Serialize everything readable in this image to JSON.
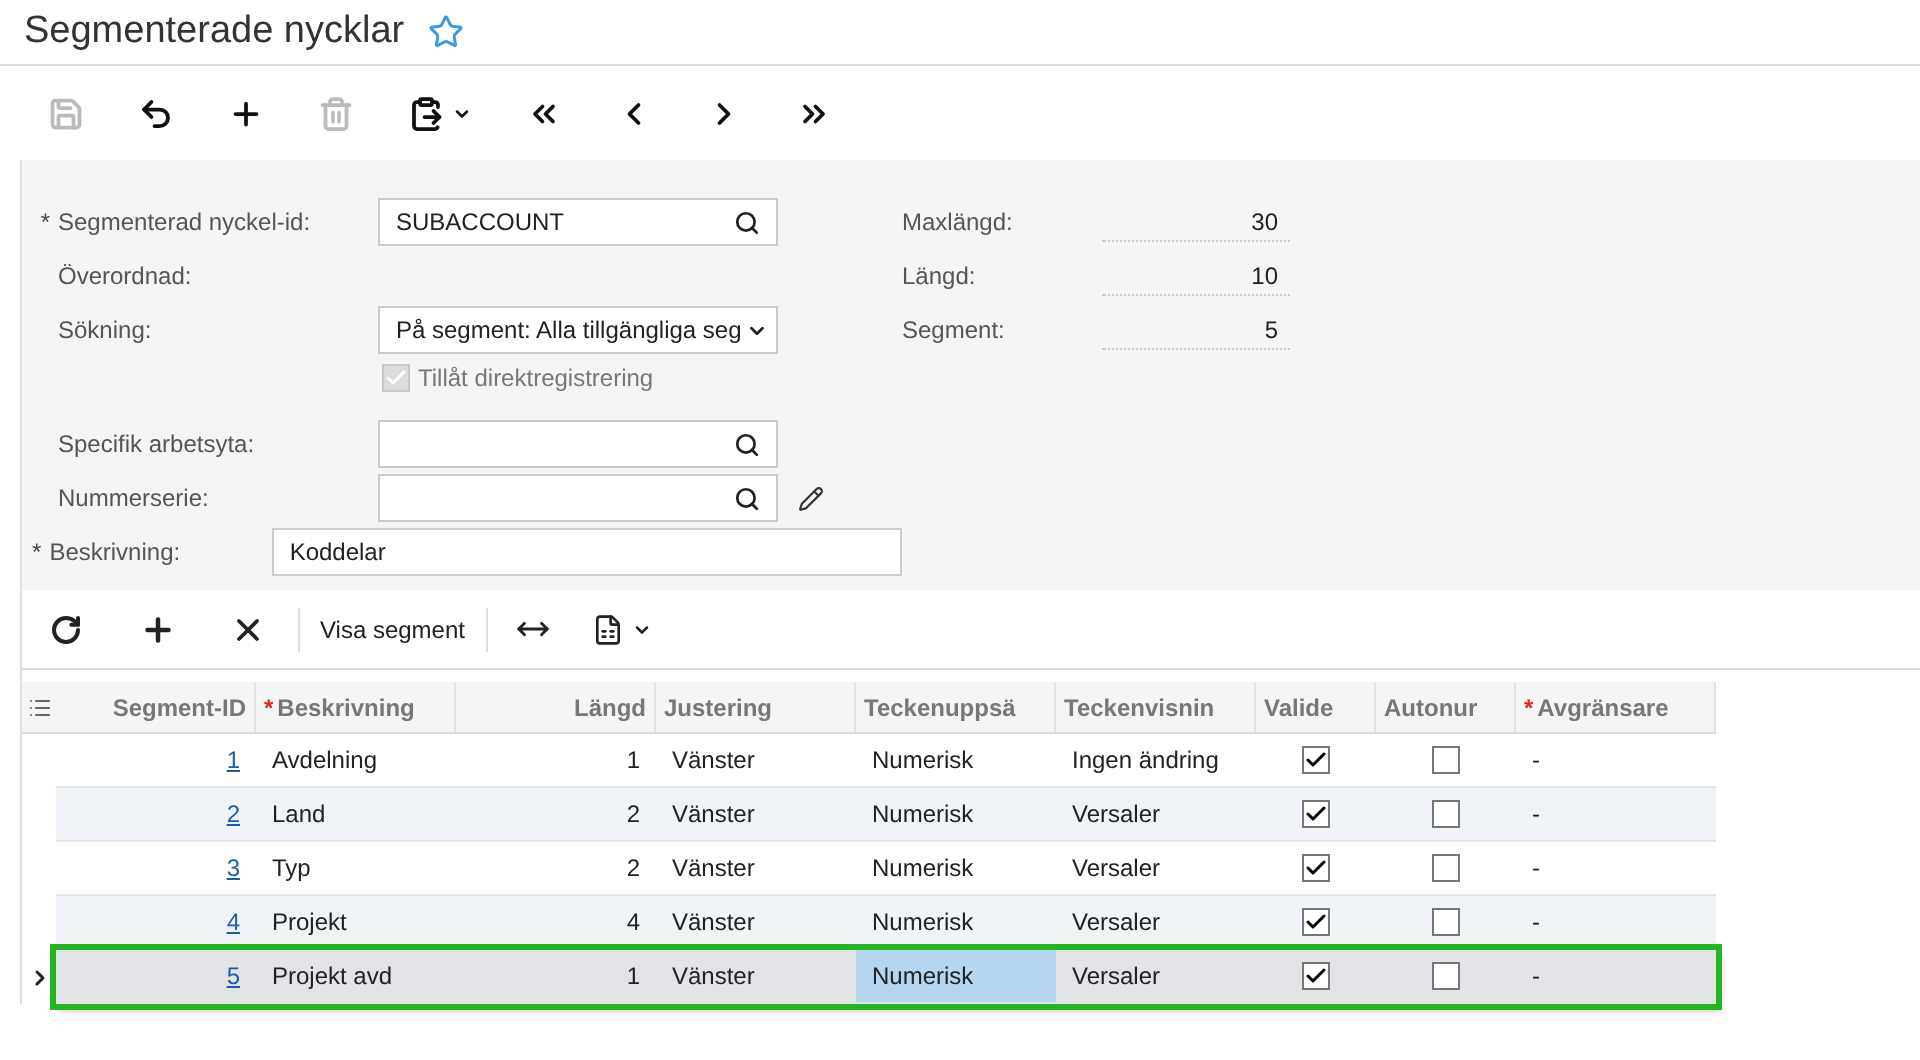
{
  "page": {
    "title": "Segmenterade nycklar",
    "favorite": false
  },
  "toolbar": [
    {
      "kind": "save",
      "disabled": true
    },
    {
      "kind": "undo",
      "disabled": false
    },
    {
      "kind": "add",
      "disabled": false
    },
    {
      "kind": "delete",
      "disabled": true
    },
    {
      "kind": "paste",
      "disabled": false
    },
    {
      "kind": "first",
      "disabled": false
    },
    {
      "kind": "prev",
      "disabled": false
    },
    {
      "kind": "next",
      "disabled": false
    },
    {
      "kind": "last",
      "disabled": false
    }
  ],
  "form": {
    "left": [
      {
        "mark": "*",
        "label": "Segmenterad nyckel-id:",
        "kind": "lookup",
        "value": "SUBACCOUNT"
      },
      {
        "label": "Överordnad:",
        "kind": "empty"
      },
      {
        "label": "Sökning:",
        "kind": "select",
        "value": "På segment: Alla tillgängliga seg"
      },
      {
        "label": "Tillåt direktregistrering",
        "kind": "checkbox",
        "checked": true,
        "disabled": true
      },
      {
        "label": "Specifik arbetsyta:",
        "kind": "lookup"
      },
      {
        "label": "Nummerserie:",
        "kind": "lookup-edit"
      },
      {
        "mark": "*",
        "label": "Beskrivning:",
        "kind": "text",
        "value": "Koddelar"
      }
    ],
    "right": [
      {
        "label": "Maxlängd:",
        "value": "30"
      },
      {
        "label": "Längd:",
        "value": "10"
      },
      {
        "label": "Segment:",
        "value": "5"
      }
    ]
  },
  "grid_toolbar": [
    {
      "kind": "refresh"
    },
    {
      "kind": "add"
    },
    {
      "kind": "remove"
    },
    {
      "kind": "text",
      "label": "Visa segment"
    },
    {
      "kind": "fit"
    },
    {
      "kind": "excel"
    }
  ],
  "table": {
    "columns": [
      {
        "label": "Segment-ID"
      },
      {
        "mark": "*",
        "label": "Beskrivning"
      },
      {
        "label": "Längd"
      },
      {
        "label": "Justering"
      },
      {
        "label": "Teckenuppsä"
      },
      {
        "label": "Teckenvisnin"
      },
      {
        "label": "Valide"
      },
      {
        "label": "Autonur"
      },
      {
        "mark": "*",
        "label": "Avgränsare"
      }
    ],
    "rows": [
      {
        "selected": false,
        "focused": false,
        "id": "1",
        "description": "Avdelning",
        "length": "1",
        "alignment": "Vänster",
        "charset": "Numerisk",
        "display": "Ingen ändring",
        "validate": true,
        "autonumber": false,
        "separator": "-"
      },
      {
        "selected": false,
        "focused": false,
        "id": "2",
        "description": "Land",
        "length": "2",
        "alignment": "Vänster",
        "charset": "Numerisk",
        "display": "Versaler",
        "validate": true,
        "autonumber": false,
        "separator": "-"
      },
      {
        "selected": false,
        "focused": false,
        "id": "3",
        "description": "Typ",
        "length": "2",
        "alignment": "Vänster",
        "charset": "Numerisk",
        "display": "Versaler",
        "validate": true,
        "autonumber": false,
        "separator": "-"
      },
      {
        "selected": false,
        "focused": false,
        "id": "4",
        "description": "Projekt",
        "length": "4",
        "alignment": "Vänster",
        "charset": "Numerisk",
        "display": "Versaler",
        "validate": true,
        "autonumber": false,
        "separator": "-"
      },
      {
        "selected": true,
        "focused": true,
        "id": "5",
        "description": "Projekt avd",
        "length": "1",
        "alignment": "Vänster",
        "charset": "Numerisk",
        "display": "Versaler",
        "validate": true,
        "autonumber": false,
        "separator": "-"
      }
    ]
  }
}
